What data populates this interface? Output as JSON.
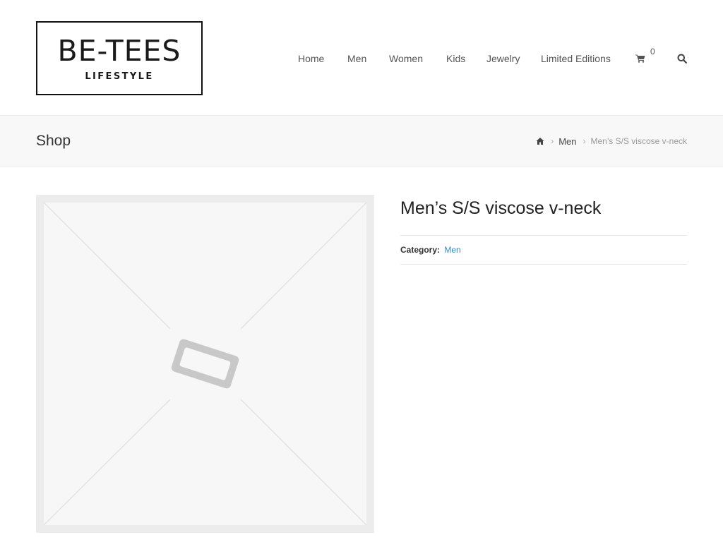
{
  "header": {
    "logo": {
      "main": "BE-TEES",
      "sub": "LIFESTYLE"
    },
    "nav": [
      {
        "label": "Home"
      },
      {
        "label": "Men"
      },
      {
        "label": "Women"
      },
      {
        "label": "Kids"
      },
      {
        "label": "Jewelry"
      },
      {
        "label": "Limited Editions"
      }
    ],
    "cart_count": "0",
    "cart_icon": "shopping-cart-icon",
    "search_icon": "search-icon"
  },
  "title_bar": {
    "title": "Shop",
    "breadcrumb": {
      "home_icon": "home-icon",
      "items": [
        {
          "label": "Men"
        }
      ],
      "current": "Men’s S/S viscose v-neck"
    }
  },
  "product": {
    "image_icon": "placeholder-image-icon",
    "title": "Men’s S/S viscose v-neck",
    "category_label": "Category:",
    "category_value": "Men"
  },
  "colors": {
    "link": "#2e8ec2",
    "title_bar_bg": "#f8f8f8",
    "placeholder_bg": "#ececec"
  }
}
